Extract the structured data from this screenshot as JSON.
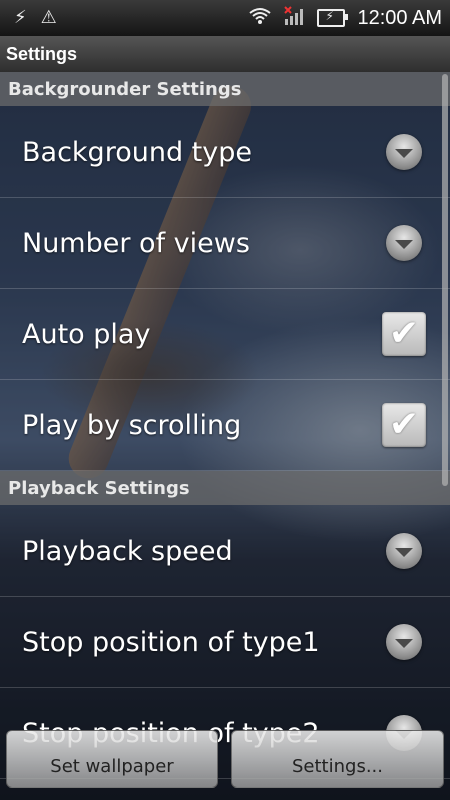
{
  "status_bar": {
    "time": "12:00 AM",
    "icons": [
      "usb-debug-icon",
      "warning-icon",
      "wifi-icon",
      "no-signal-icon",
      "battery-charging-icon"
    ]
  },
  "title_bar": {
    "title": "Settings"
  },
  "sections": [
    {
      "header": "Backgrounder Settings",
      "items": [
        {
          "label": "Background type",
          "control": "dropdown"
        },
        {
          "label": "Number of views",
          "control": "dropdown"
        },
        {
          "label": "Auto play",
          "control": "checkbox",
          "checked": true
        },
        {
          "label": "Play by scrolling",
          "control": "checkbox",
          "checked": true
        }
      ]
    },
    {
      "header": "Playback Settings",
      "items": [
        {
          "label": "Playback speed",
          "control": "dropdown"
        },
        {
          "label": "Stop position of type1",
          "control": "dropdown"
        },
        {
          "label": "Stop position of type2",
          "control": "dropdown"
        }
      ]
    }
  ],
  "buttons": {
    "set_wallpaper": "Set wallpaper",
    "settings": "Settings..."
  }
}
